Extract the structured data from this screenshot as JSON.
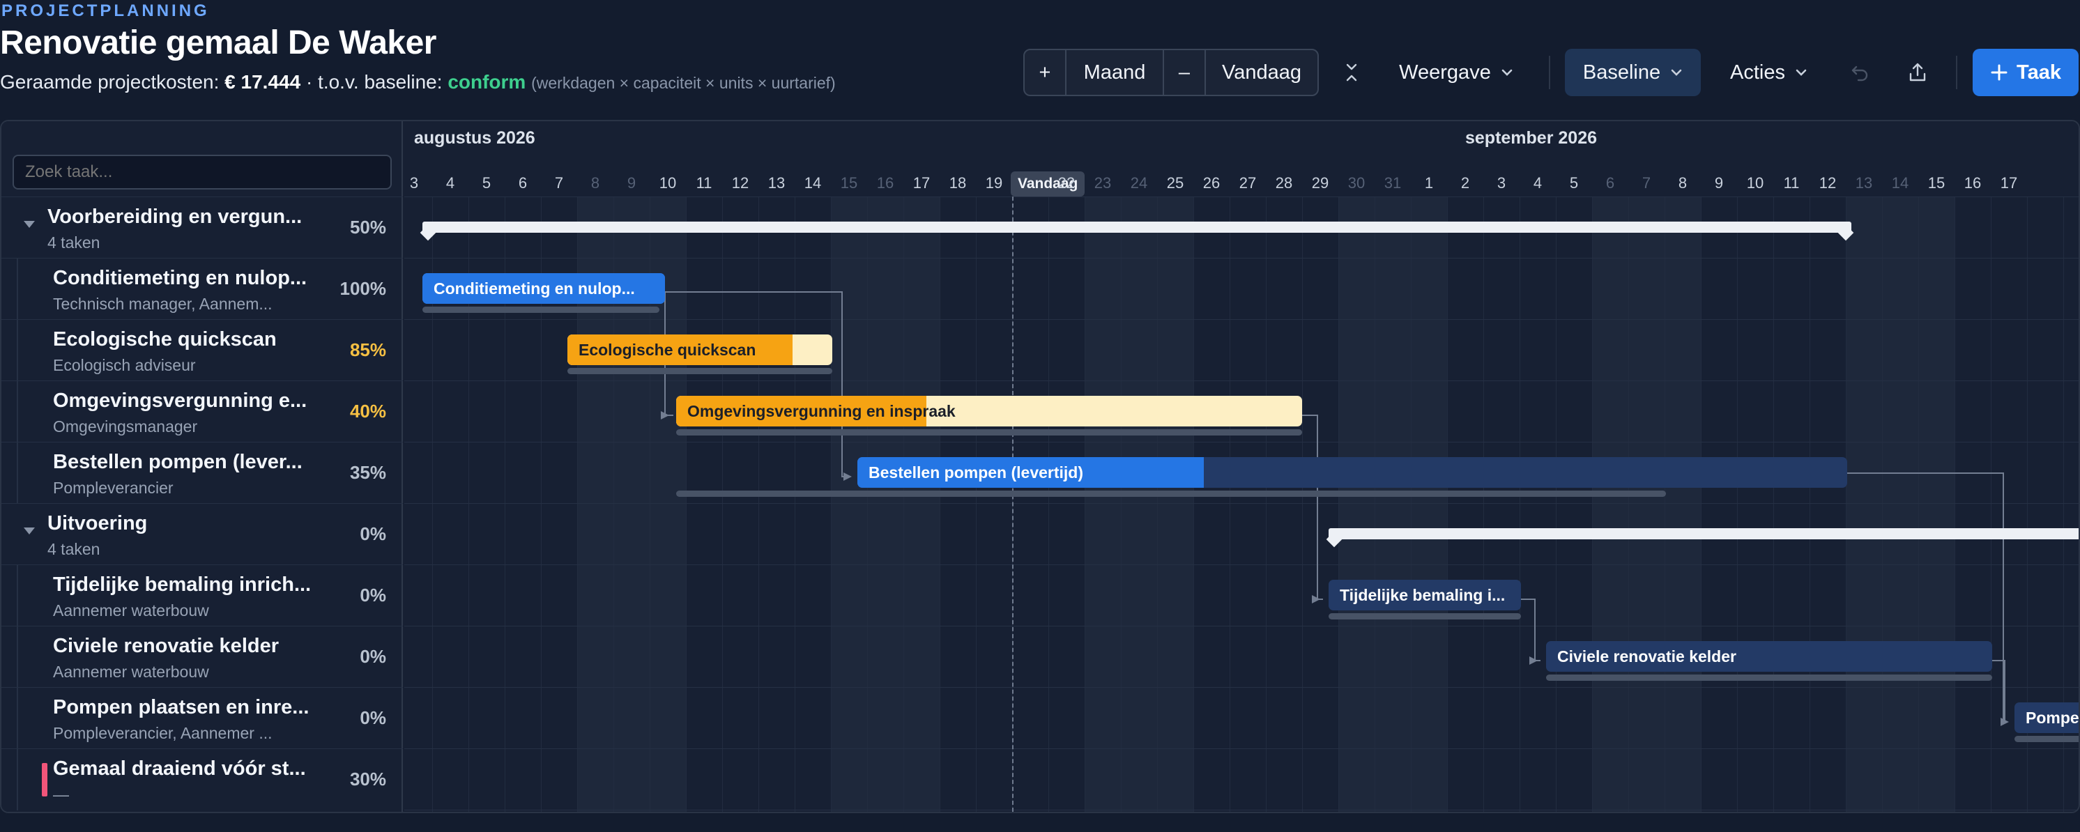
{
  "header": {
    "eyebrow": "PROJECTPLANNING",
    "title": "Renovatie gemaal De Waker",
    "cost_label": "Geraamde projectkosten:",
    "cost_value": "€ 17.444",
    "baseline_sep": " · t.o.v. baseline: ",
    "baseline_status": "conform",
    "formula": "(werkdagen × capaciteit × units × uurtarief)"
  },
  "toolbar": {
    "zoom_in": "+",
    "scale": "Maand",
    "zoom_out": "–",
    "today": "Vandaag",
    "collapse_icon": "collapse-icon",
    "view": "Weergave",
    "baseline": "Baseline",
    "actions": "Acties",
    "undo_icon": "undo-icon",
    "export_icon": "export-icon",
    "add_task": "Taak"
  },
  "search": {
    "placeholder": "Zoek taak..."
  },
  "timeline": {
    "months": [
      "augustus 2026",
      "september 2026"
    ],
    "days": [
      "3",
      "4",
      "5",
      "6",
      "7",
      "8",
      "9",
      "10",
      "11",
      "12",
      "13",
      "14",
      "15",
      "16",
      "17",
      "18",
      "19",
      "Vandaag",
      "22",
      "23",
      "24",
      "25",
      "26",
      "27",
      "28",
      "29",
      "30",
      "31",
      "1",
      "2",
      "3",
      "4",
      "5",
      "6",
      "7",
      "8",
      "9",
      "10",
      "11",
      "12",
      "13",
      "14",
      "15",
      "16",
      "17"
    ],
    "today_label": "Vandaag"
  },
  "tasks": [
    {
      "name": "Voorbereiding en vergun...",
      "sub": "4 taken",
      "pct": "50%",
      "group": true
    },
    {
      "name": "Conditiemeting en nulop...",
      "sub": "Technisch manager, Aannem...",
      "pct": "100%",
      "bar_label": "Conditiemeting en nulop..."
    },
    {
      "name": "Ecologische quickscan",
      "sub": "Ecologisch adviseur",
      "pct": "85%",
      "bar_label": "Ecologische quickscan"
    },
    {
      "name": "Omgevingsvergunning e...",
      "sub": "Omgevingsmanager",
      "pct": "40%",
      "bar_label": "Omgevingsvergunning en inspraak"
    },
    {
      "name": "Bestellen pompen (lever...",
      "sub": "Pompleverancier",
      "pct": "35%",
      "bar_label": "Bestellen pompen (levertijd)"
    },
    {
      "name": "Uitvoering",
      "sub": "4 taken",
      "pct": "0%",
      "group": true
    },
    {
      "name": "Tijdelijke bemaling inrich...",
      "sub": "Aannemer waterbouw",
      "pct": "0%",
      "bar_label": "Tijdelijke bemaling i..."
    },
    {
      "name": "Civiele renovatie kelder",
      "sub": "Aannemer waterbouw",
      "pct": "0%",
      "bar_label": "Civiele renovatie kelder"
    },
    {
      "name": "Pompen plaatsen en inre...",
      "sub": "Pompleverancier, Aannemer ...",
      "pct": "0%",
      "bar_label": "Pompe"
    },
    {
      "name": "Gemaal draaiend vóór st...",
      "sub": "—",
      "pct": "30%",
      "milestone": true
    }
  ],
  "colors": {
    "blue": "#2576e4",
    "blue_dark": "#233a66",
    "orange": "#f6a313",
    "orange_light": "#fdefc4",
    "milestone": "#f2557a",
    "accent_text_orange": "#f6c043"
  }
}
